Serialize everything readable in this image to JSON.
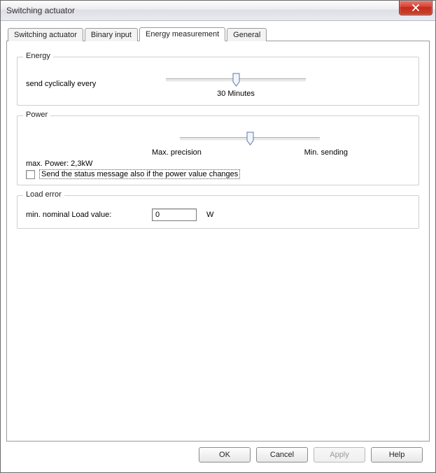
{
  "window": {
    "title": "Switching actuator"
  },
  "tabs": [
    {
      "label": "Switching actuator",
      "active": false
    },
    {
      "label": "Binary input",
      "active": false
    },
    {
      "label": "Energy measurement",
      "active": true
    },
    {
      "label": "General",
      "active": false
    }
  ],
  "energy": {
    "legend": "Energy",
    "send_label": "send cyclically every",
    "value_label": "30 Minutes",
    "slider_percent": 50
  },
  "power": {
    "legend": "Power",
    "left_label": "Max. precision",
    "right_label": "Min. sending",
    "max_power_label": "max. Power: 2,3kW",
    "slider_percent": 50,
    "checkbox_checked": false,
    "checkbox_label": "Send the status message also if the power value changes"
  },
  "load_error": {
    "legend": "Load error",
    "label": "min. nominal Load value:",
    "value": "0",
    "unit": "W"
  },
  "buttons": {
    "ok": "OK",
    "cancel": "Cancel",
    "apply": "Apply",
    "help": "Help",
    "apply_enabled": false
  }
}
